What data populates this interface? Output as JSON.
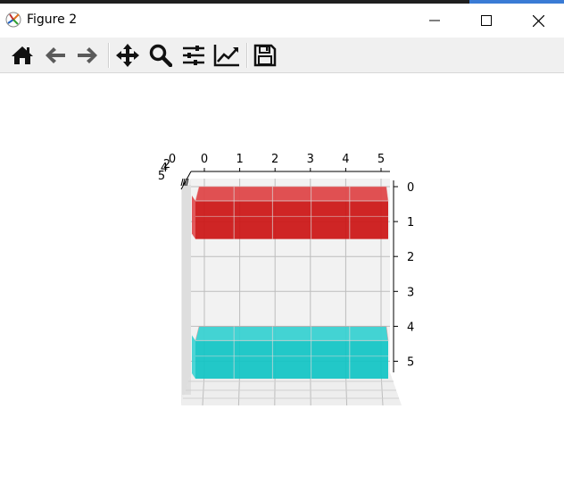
{
  "window": {
    "title": "Figure 2",
    "controls": [
      "minimize",
      "maximize",
      "close"
    ]
  },
  "toolbar": {
    "tools": [
      {
        "name": "home-icon",
        "tooltip": "Reset original view"
      },
      {
        "name": "back-icon",
        "tooltip": "Back"
      },
      {
        "name": "forward-icon",
        "tooltip": "Forward"
      },
      {
        "name": "pan-icon",
        "tooltip": "Pan"
      },
      {
        "name": "zoom-icon",
        "tooltip": "Zoom"
      },
      {
        "name": "subplots-icon",
        "tooltip": "Configure subplots"
      },
      {
        "name": "axes-edit-icon",
        "tooltip": "Edit axis"
      },
      {
        "name": "save-icon",
        "tooltip": "Save"
      }
    ]
  },
  "colors": {
    "red_bar": "#cc1414",
    "cyan_bar": "#10c4c4",
    "pane": "#f2f2f2",
    "grid": "#bdbdbd"
  },
  "chart_data": {
    "type": "bar3d",
    "x_ticks": [
      "0",
      "1",
      "2",
      "3",
      "4",
      "5"
    ],
    "z_ticks": [
      "0",
      "1",
      "2",
      "3",
      "4",
      "5"
    ],
    "y_ticks": [
      "0",
      "2",
      "4",
      "5"
    ],
    "xlim": [
      0,
      5
    ],
    "zlim": [
      0,
      5
    ],
    "z_inverted": true,
    "grid": true,
    "bars": [
      {
        "color": "red",
        "x_range": [
          0,
          5
        ],
        "z_range": [
          0,
          1.5
        ],
        "cells": 5
      },
      {
        "color": "cyan",
        "x_range": [
          0,
          5
        ],
        "z_range": [
          4,
          5.5
        ],
        "cells": 5
      }
    ]
  }
}
